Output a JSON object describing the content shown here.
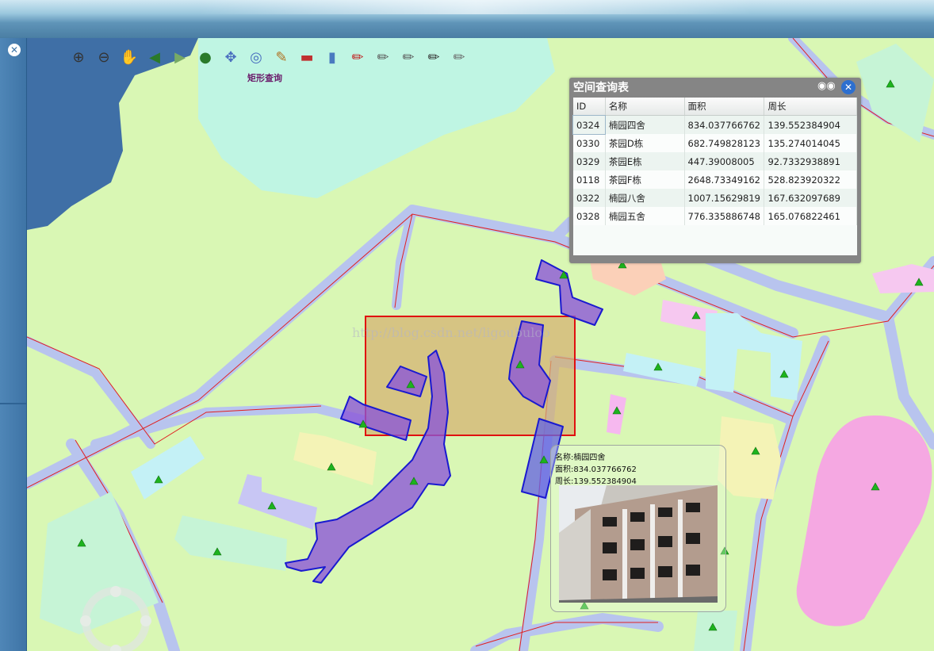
{
  "toolbar": {
    "tools": [
      {
        "name": "zoom-in-icon",
        "glyph": "⊕"
      },
      {
        "name": "zoom-out-icon",
        "glyph": "⊖"
      },
      {
        "name": "pan-hand-icon",
        "glyph": "✋"
      },
      {
        "name": "globe-back-icon",
        "glyph": "◀"
      },
      {
        "name": "globe-forward-icon",
        "glyph": "▶"
      },
      {
        "name": "full-extent-globe-icon",
        "glyph": "●"
      },
      {
        "name": "move-arrows-icon",
        "glyph": "✥"
      },
      {
        "name": "rect-query-icon",
        "glyph": "◎"
      },
      {
        "name": "measure-icon",
        "glyph": "✎"
      },
      {
        "name": "clear-graphics-icon",
        "glyph": "▬"
      },
      {
        "name": "trash-icon",
        "glyph": "▮"
      },
      {
        "name": "draw-point-icon",
        "glyph": "✏"
      },
      {
        "name": "draw-line-icon",
        "glyph": "✏"
      },
      {
        "name": "draw-polyline-icon",
        "glyph": "✏"
      },
      {
        "name": "draw-rectangle-icon",
        "glyph": "✏"
      },
      {
        "name": "draw-freehand-icon",
        "glyph": "✏"
      }
    ],
    "active_label": "矩形查询"
  },
  "watermark": "http://blog.csdn.net/ligoubuloo",
  "query_panel": {
    "title": "空间查询表",
    "columns": [
      "ID",
      "名称",
      "面积",
      "周长"
    ],
    "rows": [
      {
        "id": "0324",
        "name": "楠园四舍",
        "area": "834.037766762",
        "perimeter": "139.552384904"
      },
      {
        "id": "0330",
        "name": "茶园D栋",
        "area": "682.749828123",
        "perimeter": "135.274014045"
      },
      {
        "id": "0329",
        "name": "茶园E栋",
        "area": "447.39008005",
        "perimeter": "92.7332938891"
      },
      {
        "id": "0118",
        "name": "茶园F栋",
        "area": "2648.73349162",
        "perimeter": "528.823920322"
      },
      {
        "id": "0322",
        "name": "楠园八舍",
        "area": "1007.15629819",
        "perimeter": "167.632097689"
      },
      {
        "id": "0328",
        "name": "楠园五舍",
        "area": "776.335886748",
        "perimeter": "165.076822461"
      }
    ]
  },
  "popup": {
    "name_line": "名称:楠园四舍",
    "area_line": "面积:834.037766762",
    "perimeter_line": "周长:139.552384904"
  },
  "colors": {
    "road": "#b8c4ee",
    "boundary": "#e02020",
    "land": "#d9f7b4",
    "water": "#3f6fa6",
    "selection_fill": "#8a55d8",
    "query_rect": "#d4b070",
    "marker": "#1db31d"
  }
}
